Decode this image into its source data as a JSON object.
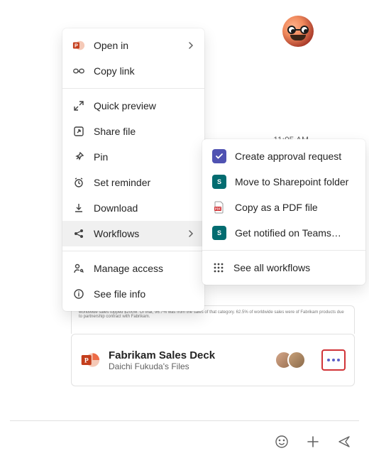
{
  "chat": {
    "timestamp": "11:05 AM"
  },
  "file_card": {
    "title": "Fabrikam Sales Deck",
    "subtitle": "Daichi Fukuda's Files",
    "preview_snippet": "worldwide sales topped $200M. Of that, 96.7% was from the sales of that category. 62.5% of worldwide sales were of Fabrikam products due to partnership contract with Fabrikam."
  },
  "context_menu": {
    "open_in": "Open in",
    "copy_link": "Copy link",
    "quick_preview": "Quick preview",
    "share_file": "Share file",
    "pin": "Pin",
    "set_reminder": "Set reminder",
    "download": "Download",
    "workflows": "Workflows",
    "manage_access": "Manage access",
    "see_file_info": "See file info"
  },
  "workflows_submenu": {
    "create_approval": "Create approval request",
    "move_sharepoint": "Move to Sharepoint folder",
    "copy_pdf": "Copy as a PDF file",
    "get_notified": "Get notified on Teams…",
    "see_all": "See all workflows"
  },
  "icons": {
    "powerpoint": "powerpoint-icon",
    "link": "link-icon",
    "expand": "expand-icon",
    "share": "share-arrow-icon",
    "pin": "pin-icon",
    "clock": "alarm-icon",
    "download": "download-icon",
    "flow": "share-nodes-icon",
    "access": "person-key-icon",
    "info": "info-icon",
    "approval": "approvals-app-icon",
    "sharepoint": "sharepoint-app-icon",
    "pdf": "pdf-icon",
    "grid": "apps-grid-icon",
    "chevron": "chevron-right-icon",
    "emoji": "emoji-icon",
    "plus": "plus-icon",
    "send": "send-icon",
    "more": "more-horizontal-icon"
  }
}
